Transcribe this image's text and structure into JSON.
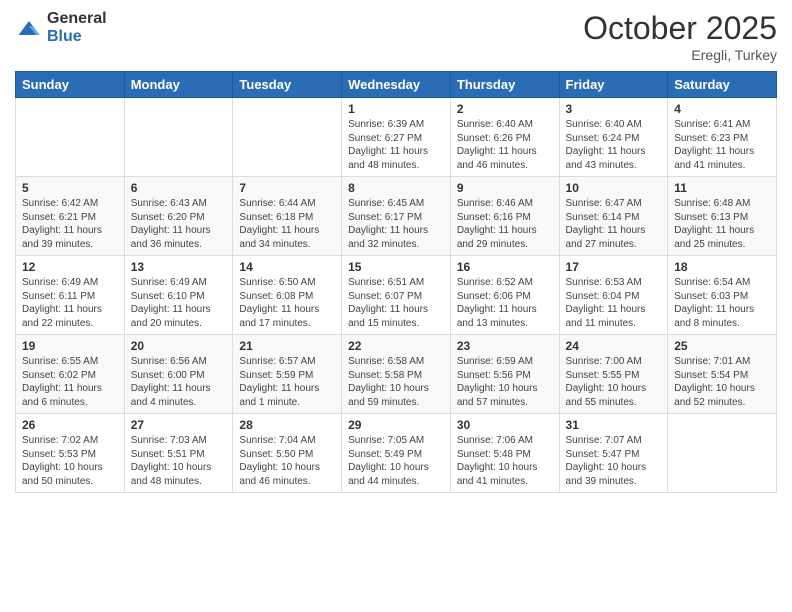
{
  "logo": {
    "general": "General",
    "blue": "Blue"
  },
  "header": {
    "month": "October 2025",
    "location": "Eregli, Turkey"
  },
  "weekdays": [
    "Sunday",
    "Monday",
    "Tuesday",
    "Wednesday",
    "Thursday",
    "Friday",
    "Saturday"
  ],
  "weeks": [
    [
      {
        "day": "",
        "info": ""
      },
      {
        "day": "",
        "info": ""
      },
      {
        "day": "",
        "info": ""
      },
      {
        "day": "1",
        "info": "Sunrise: 6:39 AM\nSunset: 6:27 PM\nDaylight: 11 hours and 48 minutes."
      },
      {
        "day": "2",
        "info": "Sunrise: 6:40 AM\nSunset: 6:26 PM\nDaylight: 11 hours and 46 minutes."
      },
      {
        "day": "3",
        "info": "Sunrise: 6:40 AM\nSunset: 6:24 PM\nDaylight: 11 hours and 43 minutes."
      },
      {
        "day": "4",
        "info": "Sunrise: 6:41 AM\nSunset: 6:23 PM\nDaylight: 11 hours and 41 minutes."
      }
    ],
    [
      {
        "day": "5",
        "info": "Sunrise: 6:42 AM\nSunset: 6:21 PM\nDaylight: 11 hours and 39 minutes."
      },
      {
        "day": "6",
        "info": "Sunrise: 6:43 AM\nSunset: 6:20 PM\nDaylight: 11 hours and 36 minutes."
      },
      {
        "day": "7",
        "info": "Sunrise: 6:44 AM\nSunset: 6:18 PM\nDaylight: 11 hours and 34 minutes."
      },
      {
        "day": "8",
        "info": "Sunrise: 6:45 AM\nSunset: 6:17 PM\nDaylight: 11 hours and 32 minutes."
      },
      {
        "day": "9",
        "info": "Sunrise: 6:46 AM\nSunset: 6:16 PM\nDaylight: 11 hours and 29 minutes."
      },
      {
        "day": "10",
        "info": "Sunrise: 6:47 AM\nSunset: 6:14 PM\nDaylight: 11 hours and 27 minutes."
      },
      {
        "day": "11",
        "info": "Sunrise: 6:48 AM\nSunset: 6:13 PM\nDaylight: 11 hours and 25 minutes."
      }
    ],
    [
      {
        "day": "12",
        "info": "Sunrise: 6:49 AM\nSunset: 6:11 PM\nDaylight: 11 hours and 22 minutes."
      },
      {
        "day": "13",
        "info": "Sunrise: 6:49 AM\nSunset: 6:10 PM\nDaylight: 11 hours and 20 minutes."
      },
      {
        "day": "14",
        "info": "Sunrise: 6:50 AM\nSunset: 6:08 PM\nDaylight: 11 hours and 17 minutes."
      },
      {
        "day": "15",
        "info": "Sunrise: 6:51 AM\nSunset: 6:07 PM\nDaylight: 11 hours and 15 minutes."
      },
      {
        "day": "16",
        "info": "Sunrise: 6:52 AM\nSunset: 6:06 PM\nDaylight: 11 hours and 13 minutes."
      },
      {
        "day": "17",
        "info": "Sunrise: 6:53 AM\nSunset: 6:04 PM\nDaylight: 11 hours and 11 minutes."
      },
      {
        "day": "18",
        "info": "Sunrise: 6:54 AM\nSunset: 6:03 PM\nDaylight: 11 hours and 8 minutes."
      }
    ],
    [
      {
        "day": "19",
        "info": "Sunrise: 6:55 AM\nSunset: 6:02 PM\nDaylight: 11 hours and 6 minutes."
      },
      {
        "day": "20",
        "info": "Sunrise: 6:56 AM\nSunset: 6:00 PM\nDaylight: 11 hours and 4 minutes."
      },
      {
        "day": "21",
        "info": "Sunrise: 6:57 AM\nSunset: 5:59 PM\nDaylight: 11 hours and 1 minute."
      },
      {
        "day": "22",
        "info": "Sunrise: 6:58 AM\nSunset: 5:58 PM\nDaylight: 10 hours and 59 minutes."
      },
      {
        "day": "23",
        "info": "Sunrise: 6:59 AM\nSunset: 5:56 PM\nDaylight: 10 hours and 57 minutes."
      },
      {
        "day": "24",
        "info": "Sunrise: 7:00 AM\nSunset: 5:55 PM\nDaylight: 10 hours and 55 minutes."
      },
      {
        "day": "25",
        "info": "Sunrise: 7:01 AM\nSunset: 5:54 PM\nDaylight: 10 hours and 52 minutes."
      }
    ],
    [
      {
        "day": "26",
        "info": "Sunrise: 7:02 AM\nSunset: 5:53 PM\nDaylight: 10 hours and 50 minutes."
      },
      {
        "day": "27",
        "info": "Sunrise: 7:03 AM\nSunset: 5:51 PM\nDaylight: 10 hours and 48 minutes."
      },
      {
        "day": "28",
        "info": "Sunrise: 7:04 AM\nSunset: 5:50 PM\nDaylight: 10 hours and 46 minutes."
      },
      {
        "day": "29",
        "info": "Sunrise: 7:05 AM\nSunset: 5:49 PM\nDaylight: 10 hours and 44 minutes."
      },
      {
        "day": "30",
        "info": "Sunrise: 7:06 AM\nSunset: 5:48 PM\nDaylight: 10 hours and 41 minutes."
      },
      {
        "day": "31",
        "info": "Sunrise: 7:07 AM\nSunset: 5:47 PM\nDaylight: 10 hours and 39 minutes."
      },
      {
        "day": "",
        "info": ""
      }
    ]
  ]
}
